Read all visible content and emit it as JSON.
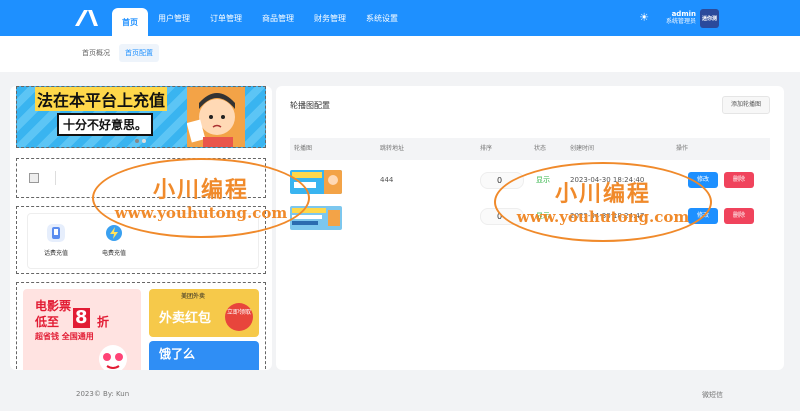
{
  "header": {
    "nav": [
      "首页",
      "用户管理",
      "订单管理",
      "商品管理",
      "财务管理",
      "系统设置"
    ],
    "active_nav": 0,
    "user": {
      "name": "admin",
      "role": "系统管理员"
    },
    "avatar_text": "迷你测",
    "theme_icon": "sun-icon",
    "logo_icon": "logo-icon",
    "brand_color": "#1e90ff"
  },
  "tabs": [
    {
      "label": "首页概况",
      "active": false
    },
    {
      "label": "首页配置",
      "active": true
    }
  ],
  "preview": {
    "banner": {
      "title": "法在本平台上充值",
      "subtitle": "十分不好意思。"
    },
    "entries": [
      {
        "label": "话费充值",
        "icon": "phone-recharge-icon"
      },
      {
        "label": "电费充值",
        "icon": "electricity-recharge-icon"
      }
    ],
    "ads": {
      "movie": {
        "line1": "电影票",
        "line2a": "低至",
        "line2b": "8",
        "line2c": "折",
        "line3": "超省钱 全国通用"
      },
      "waimai": {
        "brand": "美团外卖",
        "text": "外卖红包",
        "button": "立即领取"
      },
      "ele": {
        "text": "饿了么"
      }
    }
  },
  "carousel": {
    "title": "轮播图配置",
    "add_button": "添加轮播图",
    "columns": [
      "轮播图",
      "跳转地址",
      "排序",
      "状态",
      "创建时间",
      "操作"
    ],
    "rows": [
      {
        "link": "444",
        "sort": "0",
        "status": "显示",
        "created": "2023-04-30 18:24:40",
        "edit": "修改",
        "delete": "删除"
      },
      {
        "link": "",
        "sort": "0",
        "status": "显示",
        "created": "2023-04-30 18:24:47",
        "edit": "修改",
        "delete": "删除"
      }
    ]
  },
  "footer": {
    "left": "2023© By: Kun",
    "right": "微短信"
  },
  "watermark": {
    "line1": "小川编程",
    "line2": "www.youhutong.com"
  }
}
